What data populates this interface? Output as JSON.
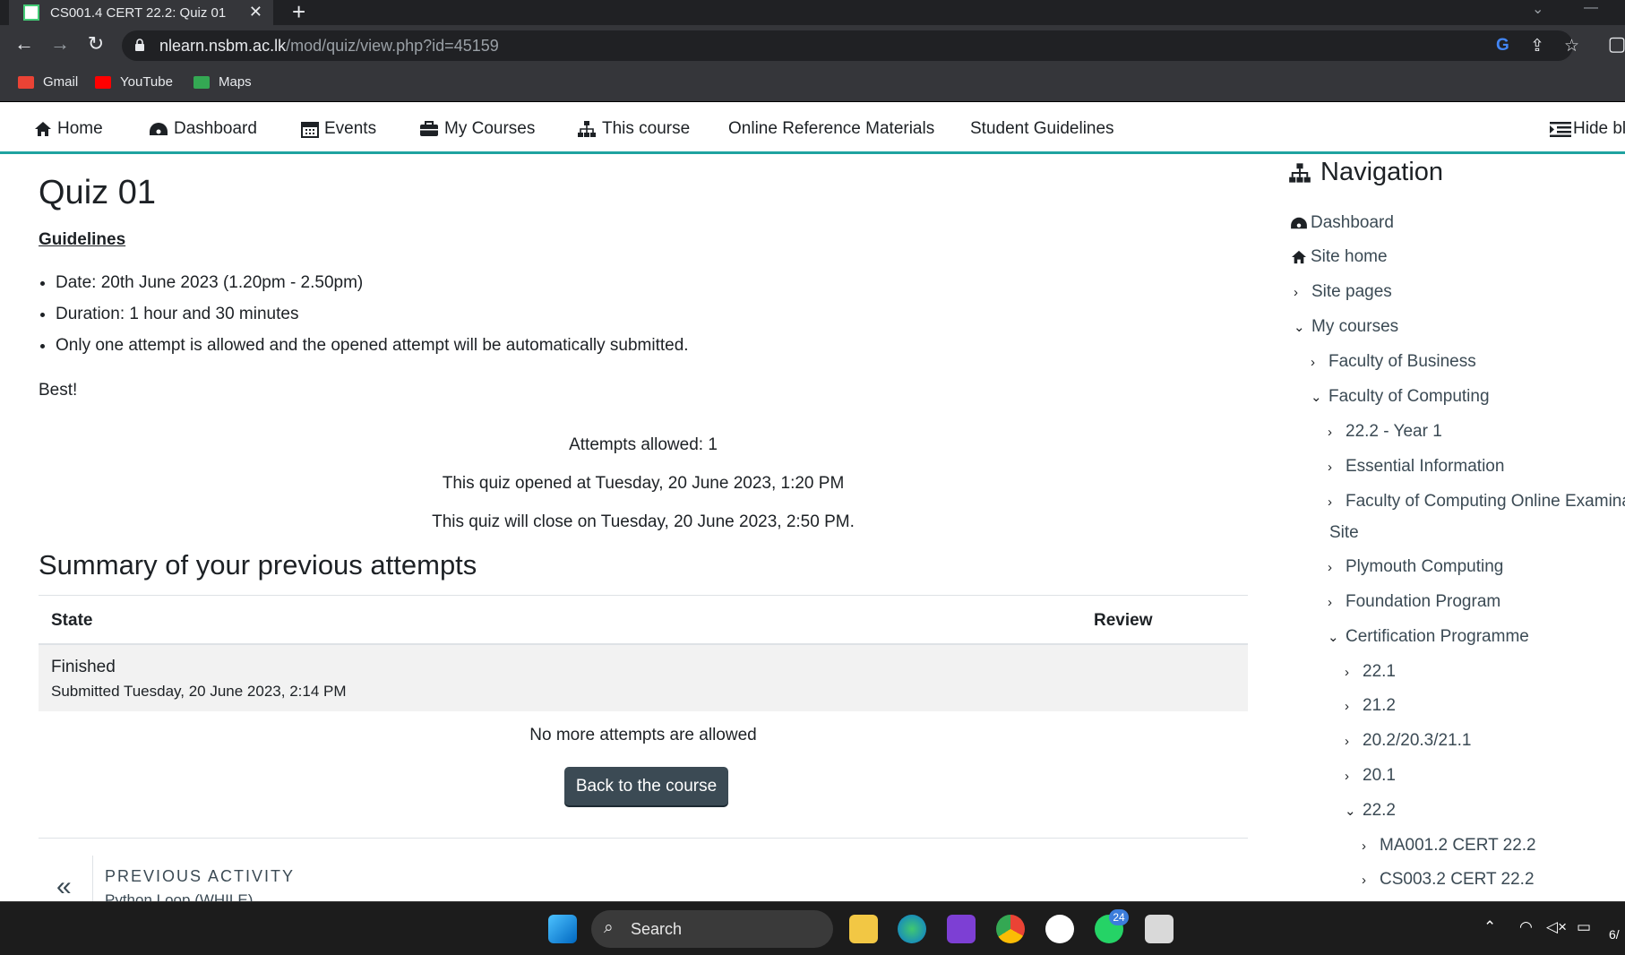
{
  "browser": {
    "tab_title": "CS001.4 CERT 22.2: Quiz 01",
    "url_host": "nlearn.nsbm.ac.lk",
    "url_path": "/mod/quiz/view.php?id=45159",
    "bookmarks": [
      "Gmail",
      "YouTube",
      "Maps"
    ]
  },
  "topnav": {
    "items": [
      "Home",
      "Dashboard",
      "Events",
      "My Courses",
      "This course",
      "Online Reference Materials",
      "Student Guidelines"
    ],
    "hide_blocks": "Hide bl"
  },
  "main": {
    "title": "Quiz 01",
    "guidelines_heading": "Guidelines",
    "guidelines": [
      "Date: 20th June 2023 (1.20pm - 2.50pm)",
      "Duration: 1 hour and 30 minutes",
      "Only one attempt is allowed and the opened attempt will be automatically submitted."
    ],
    "closing": "Best!",
    "attempts_allowed": "Attempts allowed: 1",
    "opened": "This quiz opened at Tuesday, 20 June 2023, 1:20 PM",
    "closes": "This quiz will close on Tuesday, 20 June 2023, 2:50 PM.",
    "summary_heading": "Summary of your previous attempts",
    "table": {
      "headers": [
        "State",
        "Review"
      ],
      "rows": [
        {
          "state": "Finished",
          "submitted": "Submitted Tuesday, 20 June 2023, 2:14 PM",
          "review": ""
        }
      ]
    },
    "no_more": "No more attempts are allowed",
    "back_button": "Back to the course",
    "prev_activity_label": "PREVIOUS ACTIVITY",
    "prev_activity_name": "Python Loop (WHILE)"
  },
  "sidenav": {
    "heading": "Navigation",
    "items": [
      {
        "label": "Dashboard"
      },
      {
        "label": "Site home"
      },
      {
        "label": "Site pages"
      },
      {
        "label": "My courses"
      },
      {
        "label": "Faculty of Business"
      },
      {
        "label": "Faculty of Computing"
      },
      {
        "label": "22.2 - Year 1"
      },
      {
        "label": "Essential Information"
      },
      {
        "label": "Faculty of Computing Online Examina"
      },
      {
        "label": "Site"
      },
      {
        "label": "Plymouth Computing"
      },
      {
        "label": "Foundation Program"
      },
      {
        "label": "Certification Programme"
      },
      {
        "label": "22.1"
      },
      {
        "label": "21.2"
      },
      {
        "label": "20.2/20.3/21.1"
      },
      {
        "label": "20.1"
      },
      {
        "label": "22.2"
      },
      {
        "label": "MA001.2 CERT 22.2"
      },
      {
        "label": "CS003.2 CERT 22.2"
      }
    ]
  },
  "taskbar": {
    "search": "Search",
    "whatsapp_badge": "24",
    "clock_partial": "6/"
  }
}
